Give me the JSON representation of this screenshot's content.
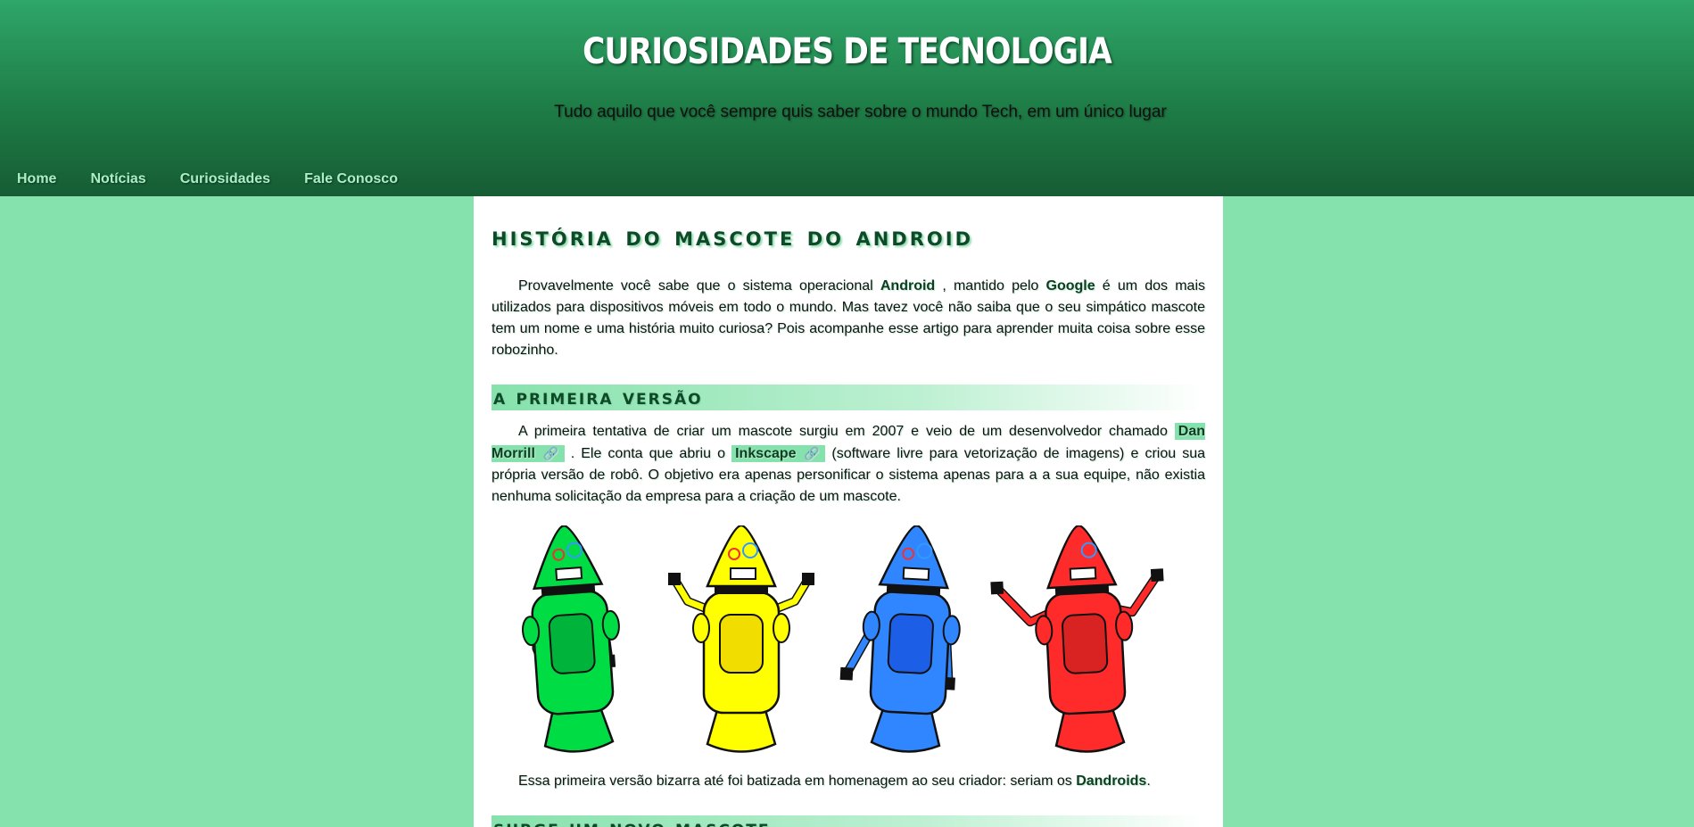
{
  "site": {
    "title": "CURIOSIDADES DE TECNOLOGIA",
    "subtitle": "Tudo aquilo que você sempre quis saber sobre o mundo Tech, em um único lugar"
  },
  "nav": [
    {
      "label": "Home"
    },
    {
      "label": "Notícias"
    },
    {
      "label": "Curiosidades"
    },
    {
      "label": "Fale Conosco"
    }
  ],
  "article": {
    "title": "História do mascote do Android",
    "intro": {
      "t1": "Provavelmente você sabe que o sistema operacional ",
      "android": "Android",
      "t2": " , mantido pelo ",
      "google": "Google",
      "t3": " é um dos mais utilizados para dispositivos móveis em todo o mundo. Mas tavez você não saiba que o seu simpático mascote tem um nome e uma história muito curiosa? Pois acompanhe esse artigo para aprender muita coisa sobre esse robozinho."
    },
    "section1": {
      "title": "A primeira versão",
      "p": {
        "t1": "A primeira tentativa de criar um mascote surgiu em 2007 e veio de um desenvolvedor chamado ",
        "link1": "Dan Morrill",
        "t2": " . Ele conta que abriu o ",
        "link2": "Inkscape",
        "t3": " (software livre para vetorização de imagens) e criou sua própria versão de robô. O objetivo era apenas personificar o sistema apenas para a a sua equipe, não existia nenhuma solicitação da empresa para a criação de um mascote."
      },
      "caption": {
        "t1": "Essa primeira versão bizarra até foi batizada em homenagem ao seu criador: seriam os ",
        "dandroids": "Dandroids",
        "t2": "."
      }
    },
    "section2": {
      "title": "Surge um novo mascote"
    }
  },
  "robots": [
    {
      "name": "green",
      "body": "#00dd44",
      "panel": "#00b33a"
    },
    {
      "name": "yellow",
      "body": "#ffff00",
      "panel": "#f2dd00"
    },
    {
      "name": "blue",
      "body": "#2f86ff",
      "panel": "#1c5fe6"
    },
    {
      "name": "red",
      "body": "#ff2a2a",
      "panel": "#d92222"
    }
  ],
  "colors": {
    "page_bg": "#86e2ac",
    "header_top": "#2fa66a",
    "header_bottom": "#165c34",
    "link_bg": "#86e2ac",
    "heading": "#0f4a28"
  },
  "icons": {
    "link": "link-icon"
  }
}
